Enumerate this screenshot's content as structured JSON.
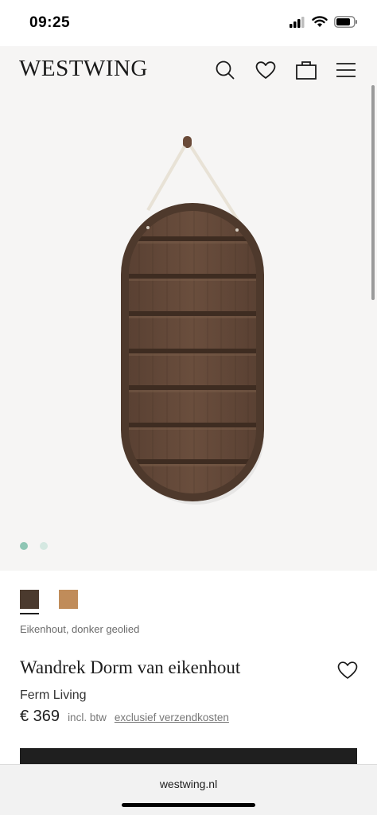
{
  "status_bar": {
    "time": "09:25"
  },
  "header": {
    "logo": "WESTWING",
    "icons": [
      "search-icon",
      "heart-icon",
      "bag-icon",
      "menu-icon"
    ]
  },
  "gallery": {
    "image_count": 2,
    "active_index": 0,
    "active_dot_color": "#8fc6b4",
    "inactive_dot_color": "#d5e8e1"
  },
  "product": {
    "swatches": [
      {
        "color": "#4b3a2e",
        "selected": true
      },
      {
        "color": "#c08c5a",
        "selected": false
      }
    ],
    "variant_label": "Eikenhout, donker geolied",
    "title": "Wandrek Dorm van eikenhout",
    "brand": "Ferm Living",
    "price": "€ 369",
    "vat_note": "incl. btw",
    "shipping_link": "exclusief verzendkosten"
  },
  "browser": {
    "url": "westwing.nl"
  }
}
